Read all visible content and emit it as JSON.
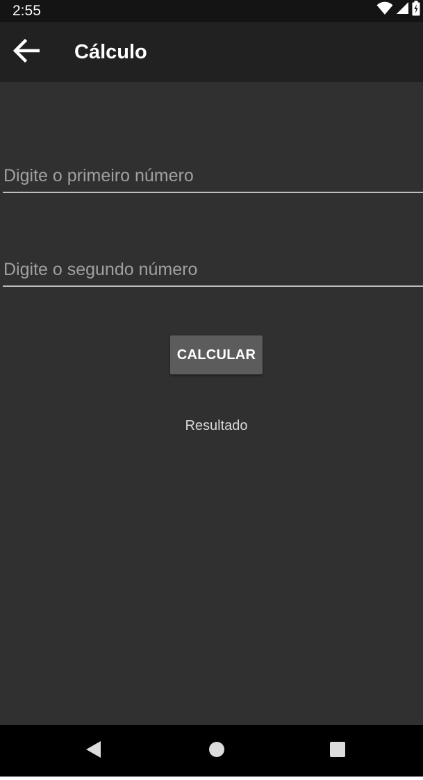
{
  "status_bar": {
    "time": "2:55",
    "icons": [
      "wifi-icon",
      "cell-signal-icon",
      "battery-icon"
    ]
  },
  "app_bar": {
    "title": "Cálculo",
    "back_icon": "arrow-left-icon"
  },
  "form": {
    "first_number": {
      "value": "",
      "placeholder": "Digite o primeiro número"
    },
    "second_number": {
      "value": "",
      "placeholder": "Digite o segundo número"
    },
    "calculate_label": "CALCULAR",
    "result_text": "Resultado"
  },
  "nav_bar": {
    "icons": [
      "nav-back-icon",
      "nav-home-icon",
      "nav-recents-icon"
    ]
  },
  "colors": {
    "background": "#303030",
    "app_bar": "#212121",
    "status_bar": "#141414",
    "button": "#5c5c5c",
    "nav_bar": "#000000"
  }
}
